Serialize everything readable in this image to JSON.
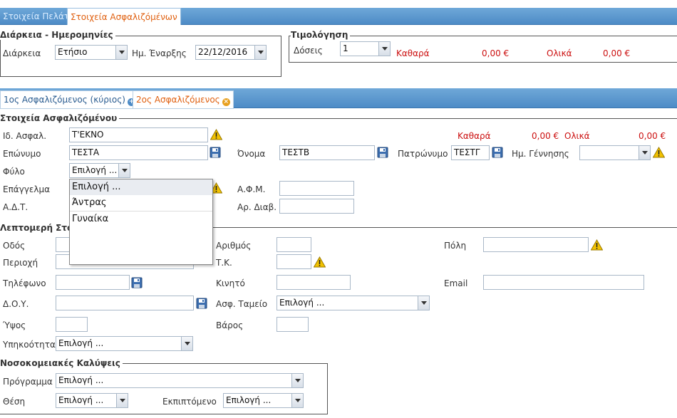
{
  "top_tabs": [
    {
      "label": "Στοιχεία Πελάτη",
      "active": false
    },
    {
      "label": "Στοιχεία Ασφαλιζόμένων",
      "active": true
    }
  ],
  "duration_section": {
    "legend": "Διάρκεια - Ημερομηνίες",
    "duration_label": "Διάρκεια",
    "duration_value": "Ετήσιο",
    "start_date_label": "Ημ. Έναρξης",
    "start_date_value": "22/12/2016"
  },
  "billing_section": {
    "legend": "Τιμολόγηση",
    "installments_label": "Δόσεις",
    "installments_value": "1",
    "net_label": "Καθαρά",
    "net_value": "0,00 €",
    "total_label": "Ολικά",
    "total_value": "0,00 €"
  },
  "insured_tabs": [
    {
      "label": "1ος Ασφαλιζόμενος (κύριος)",
      "icon": "plus-circle-icon"
    },
    {
      "label": "2ος Ασφαλιζόμενος",
      "icon": "close-circle-icon"
    }
  ],
  "insured_section": {
    "legend": "Στοιχεία Ασφαλιζόμένου",
    "id_label": "Ιδ. Ασφαλ.",
    "id_value": "Τ'ΕΚΝΟ",
    "net_label": "Καθαρά",
    "net_value": "0,00 €",
    "total_label": "Ολικά",
    "total_value": "0,00 €",
    "surname_label": "Επώνυμο",
    "surname_value": "ΤΕΣΤΑ",
    "name_label": "Όνομα",
    "name_value": "ΤΕΣΤΒ",
    "father_label": "Πατρώνυμο",
    "father_value": "ΤΕΣΤΓ",
    "birth_label": "Ημ. Γέννησης",
    "birth_value": "",
    "gender_label": "Φύλο",
    "gender_value": "Επιλογή ...",
    "profession_label": "Επάγγελμα",
    "afm_label": "Α.Φ.Μ.",
    "adt_label": "Α.Δ.Τ.",
    "passport_label": "Αρ. Διαβ."
  },
  "gender_dropdown": {
    "options": [
      "Επιλογή ...",
      "Άντρας",
      "Γυναίκα"
    ],
    "highlighted": 0
  },
  "details_section": {
    "legend": "Λεπτομερή Στοι",
    "street_label": "Οδός",
    "number_label": "Αριθμός",
    "city_label": "Πόλη",
    "area_label": "Περιοχή",
    "zip_label": "Τ.Κ.",
    "phone_label": "Τηλέφωνο",
    "mobile_label": "Κινητό",
    "email_label": "Email",
    "doy_label": "Δ.Ο.Υ.",
    "fund_label": "Ασφ. Ταμείο",
    "fund_value": "Επιλογή ...",
    "height_label": "Ύψος",
    "weight_label": "Βάρος",
    "nationality_label": "Υπηκοότητα",
    "nationality_value": "Επιλογή ..."
  },
  "hospital_section": {
    "legend": "Νοσοκομειακές Καλύψεις",
    "program_label": "Πρόγραμμα",
    "program_value": "Επιλογή ...",
    "position_label": "Θέση",
    "position_value": "Επιλογή ...",
    "deductible_label": "Εκπιπτόμενο",
    "deductible_value": "Επιλογή ..."
  },
  "colors": {
    "tab_bar": "#5b97cf",
    "active_tab_text": "#e06010",
    "money_red": "#cc1111",
    "warning_yellow": "#f2c200"
  }
}
